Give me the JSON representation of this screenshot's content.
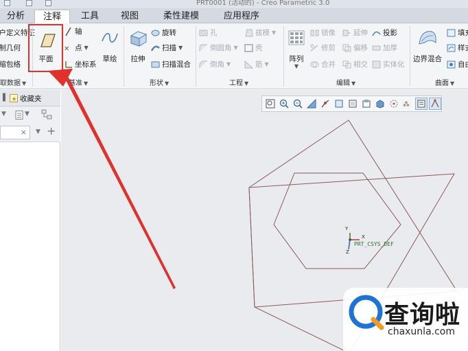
{
  "window": {
    "title": "PRT0001 (活动的) - Creo Parametric 3.0"
  },
  "tabs": [
    "分析",
    "注释",
    "工具",
    "视图",
    "柔性建模",
    "应用程序"
  ],
  "ribbon": {
    "get_data": {
      "items": [
        "用户定义特征",
        "复制几何",
        "收缩包络"
      ],
      "label": "获取数据"
    },
    "datum": {
      "plane": "平面",
      "axis": "轴",
      "point": "点",
      "csys": "坐标系",
      "sketch": "草绘",
      "label": "基准"
    },
    "shapes": {
      "extrude": "拉伸",
      "revolve": "旋转",
      "sweep": "扫描",
      "swept_blend": "扫描混合",
      "label": "形状"
    },
    "engineering": {
      "hole": "孔",
      "round": "倒圆角",
      "chamfer": "倒角",
      "draft": "拔模",
      "shell": "壳",
      "rib": "筋",
      "label": "工程"
    },
    "editing": {
      "pattern": "阵列",
      "mirror": "镜像",
      "trim": "修剪",
      "merge": "合并",
      "extend": "延伸",
      "offset": "偏移",
      "intersect": "相交",
      "project": "投影",
      "thicken": "加厚",
      "solidify": "实体化",
      "label": "编辑"
    },
    "surfaces": {
      "boundary_blend": "边界混合",
      "fill": "填充",
      "style": "样式",
      "freestyle": "自由式",
      "label": "曲面"
    }
  },
  "left_panel": {
    "favorites_tab": "收藏夹"
  },
  "canvas": {
    "csys_label": "PRT_CSYS_DEF",
    "axis_x": "X",
    "axis_y": "Y",
    "axis_z": "Z"
  },
  "watermark": {
    "text": "查询啦",
    "url": "chaxunla.com"
  },
  "colors": {
    "highlight_box": "#e0312c",
    "arrow": "#e0312c",
    "sketch_lines": "#8a5a5a",
    "canvas_bg": "#e9ebee"
  }
}
